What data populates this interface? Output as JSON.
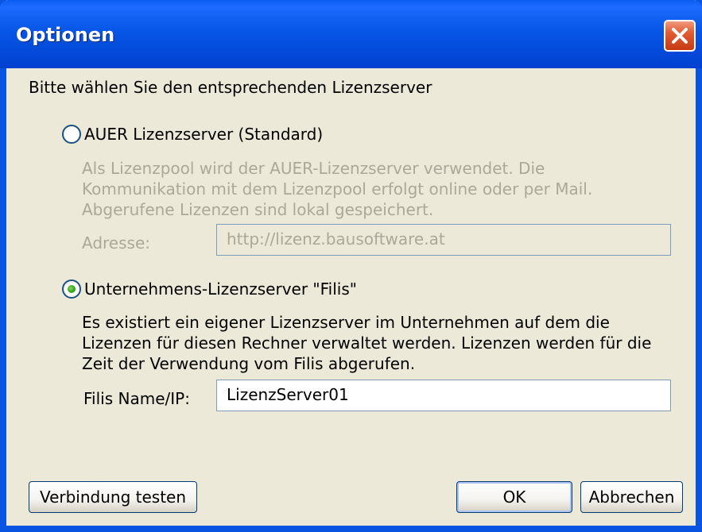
{
  "window": {
    "title": "Optionen",
    "close_icon": "close-icon"
  },
  "prompt": "Bitte wählen Sie den entsprechenden Lizenzserver",
  "options": {
    "auer": {
      "label": "AUER Lizenzserver (Standard)",
      "selected": false,
      "enabled": false,
      "description": "Als Lizenzpool wird der AUER-Lizenzserver verwendet. Die Kommunikation mit dem Lizenzpool erfolgt online oder per Mail. Abgerufene Lizenzen sind lokal gespeichert.",
      "address_label": "Adresse:",
      "address_value": "http://lizenz.bausoftware.at"
    },
    "filis": {
      "label": "Unternehmens-Lizenzserver \"Filis\"",
      "selected": true,
      "enabled": true,
      "description": "Es existiert ein eigener Lizenzserver im Unternehmen auf dem die Lizenzen für diesen Rechner verwaltet werden. Lizenzen werden für die Zeit der Verwendung vom Filis abgerufen.",
      "name_label": "Filis Name/IP:",
      "name_value": "LizenzServer01"
    }
  },
  "buttons": {
    "test": "Verbindung testen",
    "ok": "OK",
    "cancel": "Abbrechen"
  },
  "colors": {
    "titlebar": "#0A54E2",
    "dialog_bg": "#ECE9D8",
    "disabled_text": "#ACA899",
    "close_button": "#E15B33",
    "radio_selected": "#2FA315"
  }
}
